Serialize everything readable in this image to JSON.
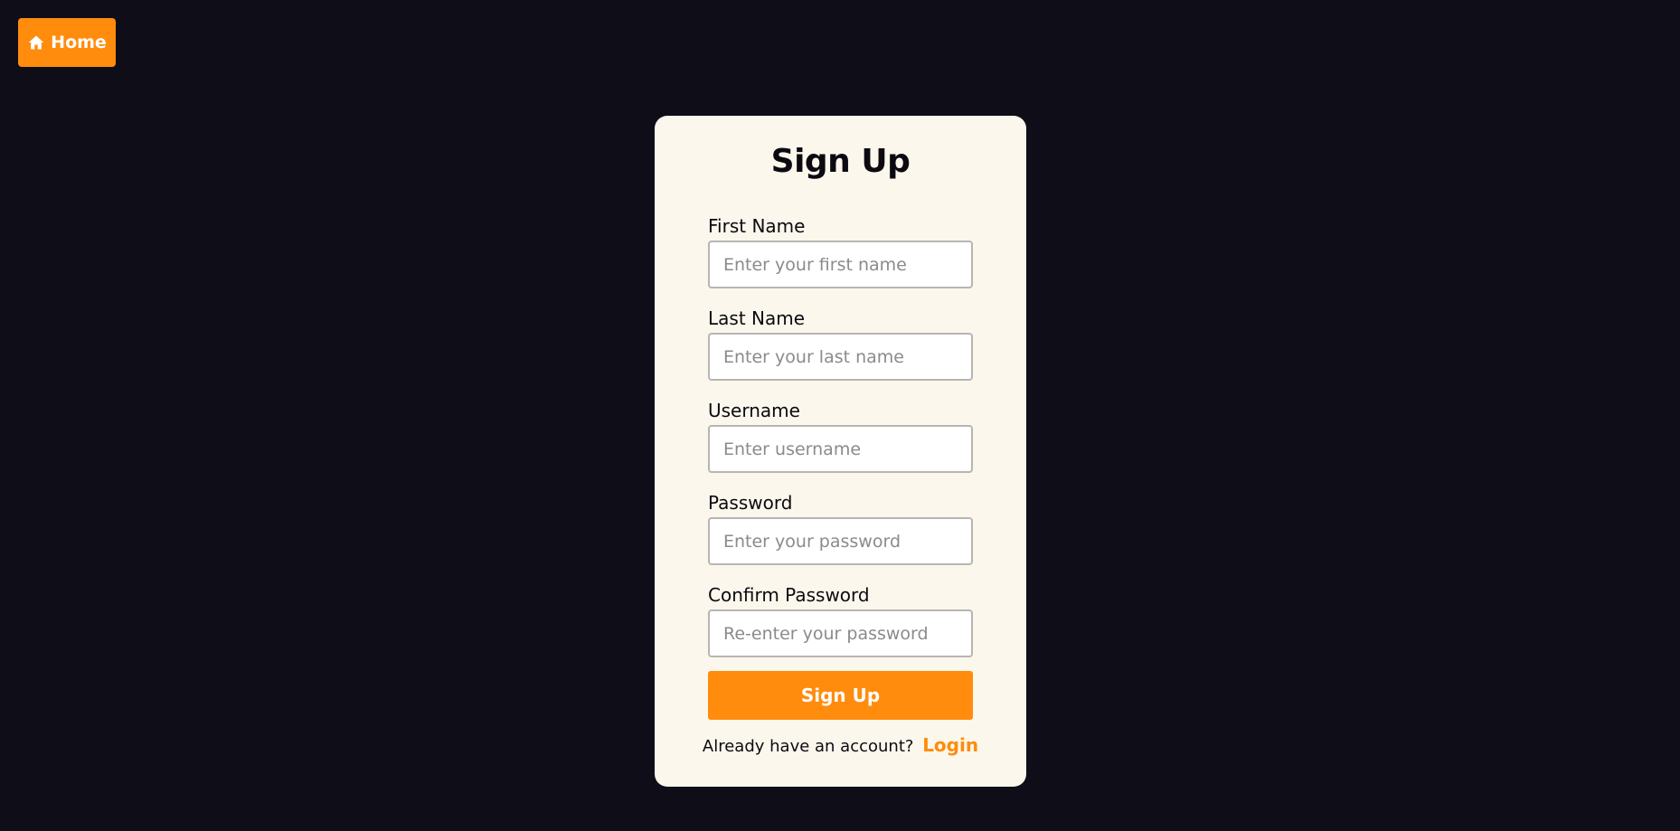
{
  "nav": {
    "home_label": "Home",
    "home_icon": "house-icon"
  },
  "form": {
    "title": "Sign Up",
    "fields": [
      {
        "label": "First Name",
        "placeholder": "Enter your first name",
        "value": ""
      },
      {
        "label": "Last Name",
        "placeholder": "Enter your last name",
        "value": ""
      },
      {
        "label": "Username",
        "placeholder": "Enter username",
        "value": ""
      },
      {
        "label": "Password",
        "placeholder": "Enter your password",
        "value": ""
      },
      {
        "label": "Confirm Password",
        "placeholder": "Re-enter your password",
        "value": ""
      }
    ],
    "submit_label": "Sign Up",
    "login_prompt": "Already have an account?",
    "login_link": "Login"
  },
  "colors": {
    "background": "#0f0d17",
    "card": "#fcf7ec",
    "accent": "#ff8c0c"
  }
}
